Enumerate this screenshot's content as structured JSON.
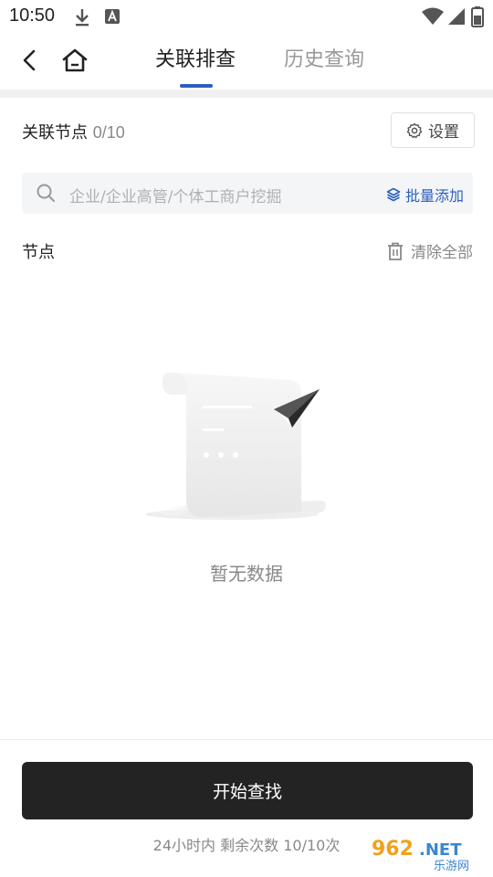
{
  "status_bar": {
    "time": "10:50",
    "icons": [
      "download-icon",
      "keyboard-a-icon",
      "wifi-icon",
      "signal-icon",
      "battery-icon"
    ]
  },
  "nav": {
    "tabs": [
      {
        "label": "关联排查",
        "active": true
      },
      {
        "label": "历史查询",
        "active": false
      }
    ],
    "accent_color": "#2b5fbd"
  },
  "header": {
    "title": "关联节点",
    "count": "0/10",
    "settings_label": "设置"
  },
  "search": {
    "placeholder": "企业/企业高管/个体工商户挖掘",
    "batch_add_label": "批量添加"
  },
  "nodes": {
    "label": "节点",
    "clear_label": "清除全部"
  },
  "empty_state": {
    "text": "暂无数据"
  },
  "footer": {
    "start_button": "开始查找",
    "remaining_text": "24小时内 剩余次数 10/10次"
  },
  "watermark": {
    "brand": "962.NET",
    "sub": "乐游网"
  }
}
